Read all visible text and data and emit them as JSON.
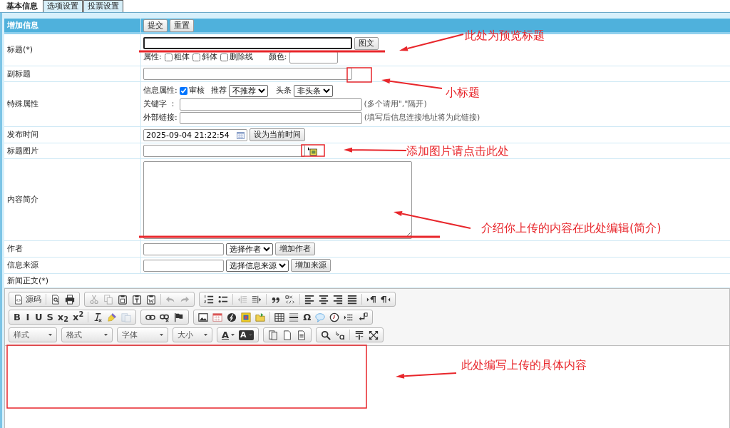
{
  "tabs": [
    {
      "label": "基本信息",
      "selected": true
    },
    {
      "label": "选项设置",
      "selected": false
    },
    {
      "label": "投票设置",
      "selected": false
    }
  ],
  "header": {
    "title": "增加信息",
    "buttons": [
      "提交",
      "重置"
    ]
  },
  "title_row": {
    "label": "标题(*)",
    "button": "图文",
    "attributes_label": "属性:",
    "styles": [
      {
        "label": "粗体",
        "checked": false
      },
      {
        "label": "斜体",
        "checked": false
      },
      {
        "label": "删除线",
        "checked": false
      }
    ],
    "color_label": "颜色:"
  },
  "subtitle_row": {
    "label": "副标题"
  },
  "special_row": {
    "label": "特殊属性",
    "info_label": "信息属性:",
    "review": {
      "label": "审核",
      "checked": true
    },
    "recommend": {
      "label": "推荐",
      "value": "不推荐"
    },
    "headline": {
      "label": "头条",
      "value": "非头条"
    },
    "keywords": {
      "label": "关键字 ：",
      "hint": "(多个请用\",\"隔开)"
    },
    "external_link": {
      "label": "外部链接:",
      "hint": "(填写后信息连接地址将为此链接)"
    }
  },
  "publish_row": {
    "label": "发布时间",
    "value": "2025-09-04 21:22:54",
    "button": "设为当前时间"
  },
  "image_row": {
    "label": "标题图片"
  },
  "summary_row": {
    "label": "内容简介"
  },
  "author_row": {
    "label": "作者",
    "select": "选择作者",
    "button": "增加作者"
  },
  "source_row": {
    "label": "信息来源",
    "select": "选择信息来源",
    "button": "增加来源"
  },
  "body_label": "新闻正文(*)",
  "toolbar": [
    [
      [
        {
          "kind": "source",
          "label": "源码",
          "disabled": false
        },
        {
          "kind": "separator"
        },
        {
          "kind": "preview",
          "disabled": false
        },
        {
          "kind": "print",
          "disabled": false
        }
      ],
      [
        {
          "kind": "cut",
          "disabled": true
        },
        {
          "kind": "copy",
          "disabled": true
        },
        {
          "kind": "paste",
          "disabled": false
        },
        {
          "kind": "paste-text",
          "disabled": false
        },
        {
          "kind": "paste-word",
          "disabled": false
        },
        {
          "kind": "separator"
        },
        {
          "kind": "undo",
          "disabled": true
        },
        {
          "kind": "redo",
          "disabled": true
        }
      ],
      [
        {
          "kind": "ol",
          "disabled": false
        },
        {
          "kind": "ul",
          "disabled": false
        },
        {
          "kind": "separator"
        },
        {
          "kind": "outdent",
          "disabled": true
        },
        {
          "kind": "indent",
          "disabled": false
        },
        {
          "kind": "separator"
        },
        {
          "kind": "blockquote",
          "disabled": false
        },
        {
          "kind": "div",
          "disabled": false
        },
        {
          "kind": "separator"
        },
        {
          "kind": "align-left",
          "disabled": false
        },
        {
          "kind": "align-center",
          "disabled": false
        },
        {
          "kind": "align-right",
          "disabled": false
        },
        {
          "kind": "align-justify",
          "disabled": false
        },
        {
          "kind": "separator"
        },
        {
          "kind": "ltr",
          "disabled": false
        },
        {
          "kind": "rtl",
          "disabled": false
        }
      ]
    ],
    [
      [
        {
          "kind": "glyph",
          "glyph": "B",
          "disabled": false
        },
        {
          "kind": "glyph",
          "glyph": "I",
          "disabled": false
        },
        {
          "kind": "glyph",
          "glyph": "U",
          "disabled": false
        },
        {
          "kind": "glyph",
          "glyph": "S",
          "disabled": false
        },
        {
          "kind": "glyph",
          "glyph": "x$_{2}$",
          "disabled": false
        },
        {
          "kind": "glyph",
          "glyph": "x$^{2}$",
          "disabled": false
        },
        {
          "kind": "separator"
        },
        {
          "kind": "removeformat",
          "disabled": false
        },
        {
          "kind": "brush",
          "disabled": false
        },
        {
          "kind": "pasteformat",
          "disabled": true
        }
      ],
      [
        {
          "kind": "link",
          "disabled": false
        },
        {
          "kind": "unlink",
          "disabled": false
        },
        {
          "kind": "anchor",
          "disabled": false
        }
      ],
      [
        {
          "kind": "image",
          "disabled": false
        },
        {
          "kind": "calendar",
          "disabled": false
        },
        {
          "kind": "disc",
          "disabled": false
        },
        {
          "kind": "template",
          "disabled": false
        },
        {
          "kind": "folder",
          "disabled": false
        },
        {
          "kind": "separator"
        },
        {
          "kind": "table",
          "disabled": false
        },
        {
          "kind": "hr",
          "disabled": false
        },
        {
          "kind": "glyph",
          "glyph": "Ω",
          "disabled": false
        },
        {
          "kind": "comment",
          "disabled": false
        },
        {
          "kind": "clock",
          "disabled": false
        },
        {
          "kind": "pagebreak",
          "disabled": false
        },
        {
          "kind": "br",
          "disabled": false
        }
      ]
    ],
    [
      [
        {
          "kind": "combo",
          "label": "样式"
        }
      ],
      [
        {
          "kind": "combo",
          "label": "格式"
        }
      ],
      [
        {
          "kind": "combo",
          "label": "字体"
        }
      ],
      [
        {
          "kind": "combo",
          "label": "大小"
        }
      ],
      [
        {
          "kind": "glyph-menu",
          "glyph": "A",
          "disabled": false
        },
        {
          "kind": "glyph-box-menu",
          "glyph": "A",
          "disabled": false
        }
      ],
      [
        {
          "kind": "pages",
          "disabled": false
        },
        {
          "kind": "page",
          "disabled": false
        },
        {
          "kind": "page-lines",
          "disabled": false
        }
      ],
      [
        {
          "kind": "find",
          "disabled": false
        },
        {
          "kind": "replace",
          "disabled": false
        },
        {
          "kind": "separator"
        },
        {
          "kind": "showblocks",
          "disabled": false
        },
        {
          "kind": "maximize",
          "disabled": false
        }
      ]
    ]
  ],
  "annotations": [
    {
      "text": "此处为预览标题"
    },
    {
      "text": "小标题"
    },
    {
      "text": "添加图片请点击此处"
    },
    {
      "text": "介绍你上传的内容在此处编辑(简介)"
    },
    {
      "text": "此处编写上传的具体内容"
    }
  ]
}
